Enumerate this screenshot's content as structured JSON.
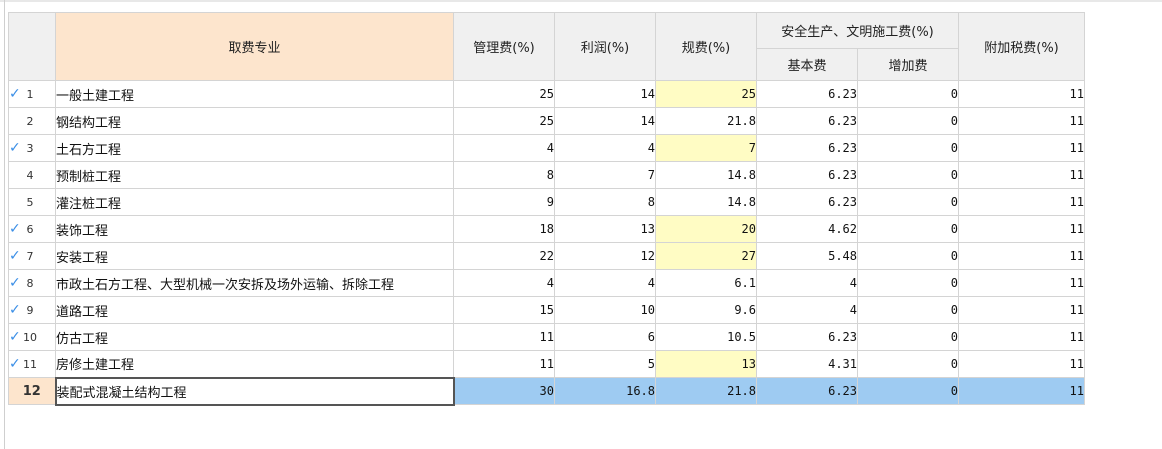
{
  "headers": {
    "category": "取费专业",
    "management": "管理费(%)",
    "profit": "利润(%)",
    "regulation": "规费(%)",
    "safety_group": "安全生产、文明施工费(%)",
    "safety_base": "基本费",
    "safety_extra": "增加费",
    "tax": "附加税费(%)"
  },
  "rows": [
    {
      "index": "1",
      "checked": "✓",
      "name": "一般土建工程",
      "management": "25",
      "profit": "14",
      "regulation": "25",
      "safety_base": "6.23",
      "safety_extra": "0",
      "tax": "11"
    },
    {
      "index": "2",
      "checked": "",
      "name": "钢结构工程",
      "management": "25",
      "profit": "14",
      "regulation": "21.8",
      "safety_base": "6.23",
      "safety_extra": "0",
      "tax": "11"
    },
    {
      "index": "3",
      "checked": "✓",
      "name": "土石方工程",
      "management": "4",
      "profit": "4",
      "regulation": "7",
      "safety_base": "6.23",
      "safety_extra": "0",
      "tax": "11"
    },
    {
      "index": "4",
      "checked": "",
      "name": "预制桩工程",
      "management": "8",
      "profit": "7",
      "regulation": "14.8",
      "safety_base": "6.23",
      "safety_extra": "0",
      "tax": "11"
    },
    {
      "index": "5",
      "checked": "",
      "name": "灌注桩工程",
      "management": "9",
      "profit": "8",
      "regulation": "14.8",
      "safety_base": "6.23",
      "safety_extra": "0",
      "tax": "11"
    },
    {
      "index": "6",
      "checked": "✓",
      "name": "装饰工程",
      "management": "18",
      "profit": "13",
      "regulation": "20",
      "safety_base": "4.62",
      "safety_extra": "0",
      "tax": "11"
    },
    {
      "index": "7",
      "checked": "✓",
      "name": "安装工程",
      "management": "22",
      "profit": "12",
      "regulation": "27",
      "safety_base": "5.48",
      "safety_extra": "0",
      "tax": "11"
    },
    {
      "index": "8",
      "checked": "✓",
      "name": "市政土石方工程、大型机械一次安拆及场外运输、拆除工程",
      "management": "4",
      "profit": "4",
      "regulation": "6.1",
      "safety_base": "4",
      "safety_extra": "0",
      "tax": "11"
    },
    {
      "index": "9",
      "checked": "✓",
      "name": "道路工程",
      "management": "15",
      "profit": "10",
      "regulation": "9.6",
      "safety_base": "4",
      "safety_extra": "0",
      "tax": "11"
    },
    {
      "index": "10",
      "checked": "✓",
      "name": "仿古工程",
      "management": "11",
      "profit": "6",
      "regulation": "10.5",
      "safety_base": "6.23",
      "safety_extra": "0",
      "tax": "11"
    },
    {
      "index": "11",
      "checked": "✓",
      "name": "房修土建工程",
      "management": "11",
      "profit": "5",
      "regulation": "13",
      "safety_base": "4.31",
      "safety_extra": "0",
      "tax": "11"
    },
    {
      "index": "12",
      "checked": "",
      "name": "装配式混凝土结构工程",
      "management": "30",
      "profit": "16.8",
      "regulation": "21.8",
      "safety_base": "6.23",
      "safety_extra": "0",
      "tax": "11"
    }
  ],
  "highlighted_regulation_rows": [
    "1",
    "3",
    "6",
    "7",
    "11"
  ],
  "selected_row": "12",
  "colors": {
    "header_bg": "#f0f0f0",
    "category_header_bg": "#fde5cd",
    "highlight_cell": "#fffcc4",
    "selected_row": "#9ecbf2",
    "check_color": "#3a8ee6"
  }
}
